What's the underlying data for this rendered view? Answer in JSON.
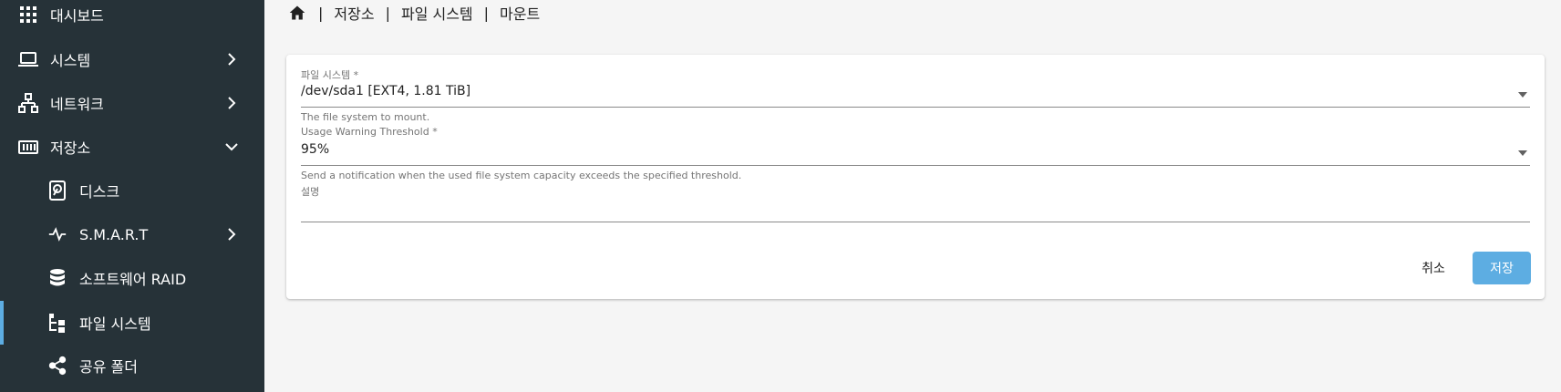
{
  "sidebar": {
    "items": [
      {
        "label": "대시보드",
        "icon": "dashboard-grid-icon"
      },
      {
        "label": "시스템",
        "icon": "laptop-icon",
        "chevron": "chevron-right-icon"
      },
      {
        "label": "네트워크",
        "icon": "network-icon",
        "chevron": "chevron-right-icon"
      },
      {
        "label": "저장소",
        "icon": "storage-icon",
        "chevron": "chevron-down-icon"
      },
      {
        "label": "디스크",
        "icon": "hard-disk-icon"
      },
      {
        "label": "S.M.A.R.T",
        "icon": "pulse-icon",
        "chevron": "chevron-right-icon"
      },
      {
        "label": "소프트웨어 RAID",
        "icon": "database-icon"
      },
      {
        "label": "파일 시스템",
        "icon": "file-tree-icon"
      },
      {
        "label": "공유 폴더",
        "icon": "share-icon"
      }
    ],
    "active_item": "파일 시스템"
  },
  "breadcrumb": {
    "home_icon": "home-icon",
    "items": [
      "저장소",
      "파일 시스템",
      "마운트"
    ],
    "separator": "|"
  },
  "form": {
    "filesystem": {
      "label": "파일 시스템 *",
      "value": "/dev/sda1 [EXT4, 1.81 TiB]",
      "hint": "The file system to mount."
    },
    "threshold": {
      "label": "Usage Warning Threshold *",
      "value": "95%",
      "hint": "Send a notification when the used file system capacity exceeds the specified threshold."
    },
    "description": {
      "label": "설명",
      "value": ""
    },
    "cancel_label": "취소",
    "save_label": "저장"
  },
  "colors": {
    "sidebar_bg": "#263238",
    "accent": "#5dade2",
    "save_button": "#5dade2",
    "page_bg": "#f5f5f5"
  }
}
